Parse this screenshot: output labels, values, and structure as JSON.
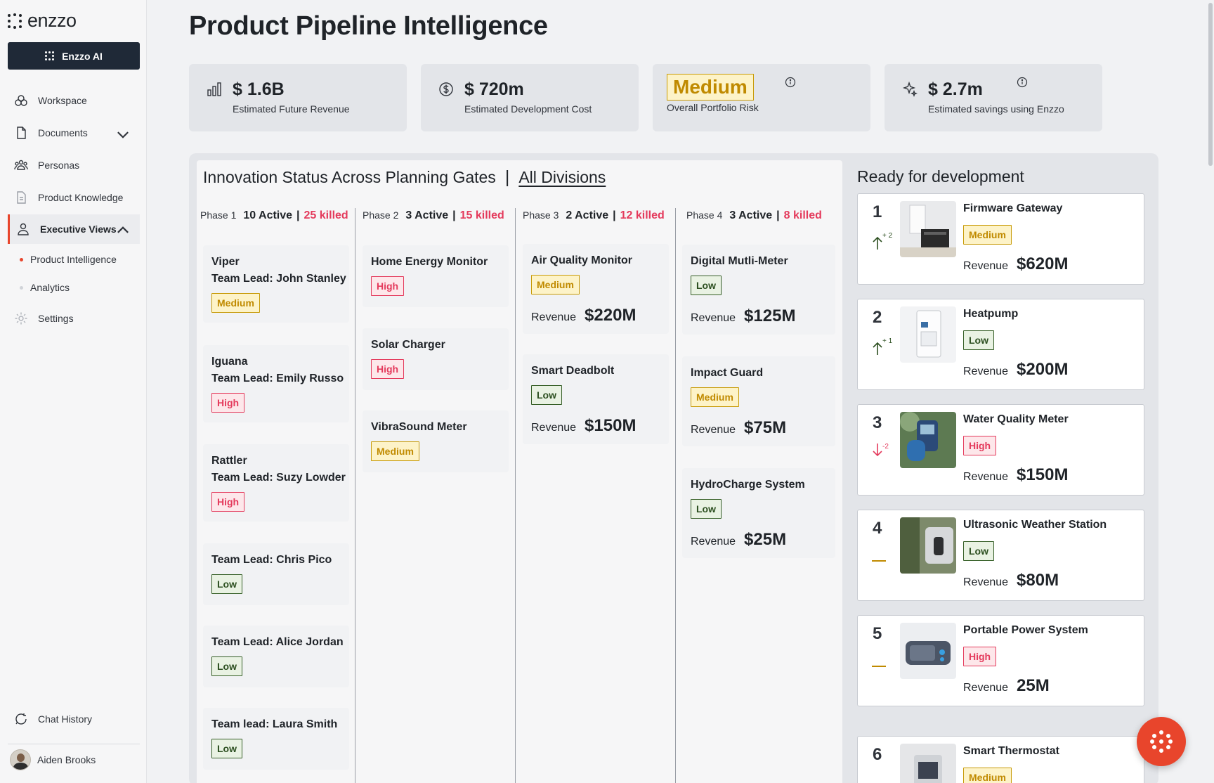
{
  "sidebar": {
    "logo": "enzzo",
    "ai_button": "Enzzo AI",
    "nav": {
      "workspace": "Workspace",
      "documents": "Documents",
      "personas": "Personas",
      "product_knowledge": "Product Knowledge",
      "executive_views": "Executive Views",
      "product_intelligence": "Product Intelligence",
      "analytics": "Analytics",
      "settings": "Settings",
      "chat_history": "Chat History"
    },
    "user": "Aiden Brooks"
  },
  "page": {
    "title": "Product Pipeline Intelligence"
  },
  "kpis": {
    "revenue": {
      "value": "$ 1.6B",
      "label": "Estimated Future Revenue"
    },
    "cost": {
      "value": "$ 720m",
      "label": "Estimated  Development Cost"
    },
    "risk": {
      "value": "Medium",
      "label": "Overall Portfolio Risk"
    },
    "savings": {
      "value": "$ 2.7m",
      "label": "Estimated savings using Enzzo"
    }
  },
  "status": {
    "title": "Innovation Status Across Planning Gates",
    "separator": "|",
    "division": "All Divisions",
    "phases": [
      {
        "name": "Phase 1",
        "active": "10 Active",
        "bar": "|",
        "killed": "25 killed"
      },
      {
        "name": "Phase 2",
        "active": "3 Active",
        "bar": "|",
        "killed": "15 killed"
      },
      {
        "name": "Phase 3",
        "active": "2 Active",
        "bar": "|",
        "killed": "12 killed"
      },
      {
        "name": "Phase 4",
        "active": "3 Active",
        "bar": "|",
        "killed": "8 killed"
      }
    ],
    "revenue_label": "Revenue",
    "phase1": [
      {
        "title1": "Viper",
        "title2": "Team Lead: John Stanley",
        "risk": "Medium"
      },
      {
        "title1": "Iguana",
        "title2": "Team Lead: Emily Russo",
        "risk": "High"
      },
      {
        "title1": "Rattler",
        "title2": "Team Lead: Suzy Lowder",
        "risk": "High"
      },
      {
        "title1": "Team Lead: Chris Pico",
        "risk": "Low"
      },
      {
        "title1": "Team Lead: Alice Jordan",
        "risk": "Low"
      },
      {
        "title1": "Team lead: Laura Smith",
        "risk": "Low"
      }
    ],
    "phase2": [
      {
        "title": "Home Energy Monitor",
        "risk": "High"
      },
      {
        "title": "Solar Charger",
        "risk": "High"
      },
      {
        "title": "VibraSound Meter",
        "risk": "Medium"
      }
    ],
    "phase3": [
      {
        "title": "Air Quality Monitor",
        "risk": "Medium",
        "revenue": "$220M"
      },
      {
        "title": "Smart Deadbolt",
        "risk": "Low",
        "revenue": "$150M"
      }
    ],
    "phase4": [
      {
        "title": "Digital Mutli-Meter",
        "risk": "Low",
        "revenue": "$125M"
      },
      {
        "title": "Impact Guard",
        "risk": "Medium",
        "revenue": "$75M"
      },
      {
        "title": "HydroCharge System",
        "risk": "Low",
        "revenue": "$25M"
      }
    ]
  },
  "ready": {
    "title": "Ready for development",
    "revenue_label": "Revenue",
    "items": [
      {
        "rank": "1",
        "change": "+ 2",
        "name": "Firmware Gateway",
        "risk": "Medium",
        "revenue": "$620M"
      },
      {
        "rank": "2",
        "change": "+ 1",
        "name": "Heatpump",
        "risk": "Low",
        "revenue": "$200M"
      },
      {
        "rank": "3",
        "change": "-2",
        "name": "Water Quality Meter",
        "risk": "High",
        "revenue": "$150M"
      },
      {
        "rank": "4",
        "change": "",
        "name": "Ultrasonic Weather Station",
        "risk": "Low",
        "revenue": "$80M"
      },
      {
        "rank": "5",
        "change": "",
        "name": "Portable Power System",
        "risk": "High",
        "revenue": "25M"
      },
      {
        "rank": "6",
        "change": "",
        "name": "Smart Thermostat",
        "risk": "Medium",
        "revenue": ""
      }
    ]
  },
  "colors": {
    "accent": "#e8452c",
    "high": "#e43a5c",
    "medium": "#c08a00",
    "low": "#2c4f20"
  }
}
